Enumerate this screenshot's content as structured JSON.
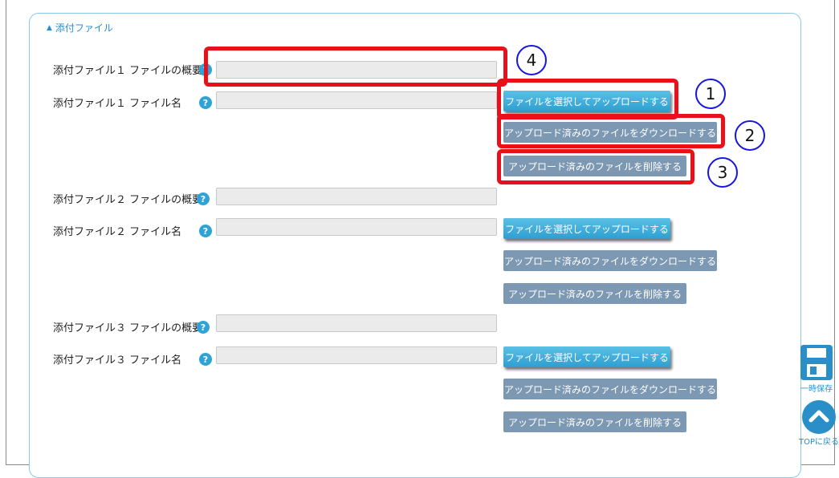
{
  "section": {
    "title": "添付ファイル",
    "toggle_icon": "triangle-up-icon"
  },
  "attachments": [
    {
      "summary_label": "添付ファイル１ ファイルの概要",
      "summary_value": "",
      "filename_label": "添付ファイル１ ファイル名",
      "filename_value": "",
      "upload_label": "ファイルを選択してアップロードする",
      "download_label": "アップロード済みのファイルをダウンロードする",
      "delete_label": "アップロード済みのファイルを削除する"
    },
    {
      "summary_label": "添付ファイル２ ファイルの概要",
      "summary_value": "",
      "filename_label": "添付ファイル２ ファイル名",
      "filename_value": "",
      "upload_label": "ファイルを選択してアップロードする",
      "download_label": "アップロード済みのファイルをダウンロードする",
      "delete_label": "アップロード済みのファイルを削除する"
    },
    {
      "summary_label": "添付ファイル３ ファイルの概要",
      "summary_value": "",
      "filename_label": "添付ファイル３ ファイル名",
      "filename_value": "",
      "upload_label": "ファイルを選択してアップロードする",
      "download_label": "アップロード済みのファイルをダウンロードする",
      "delete_label": "アップロード済みのファイルを削除する"
    }
  ],
  "help_icon_glyph": "?",
  "callouts": [
    "1",
    "2",
    "3",
    "4"
  ],
  "side": {
    "save_label": "一時保存",
    "top_label": "TOPに戻る"
  },
  "colors": {
    "accent": "#2fa3d8",
    "callout_box": "#e8101a",
    "callout_circle": "#1616e0",
    "gray_button": "#7d98b3"
  }
}
